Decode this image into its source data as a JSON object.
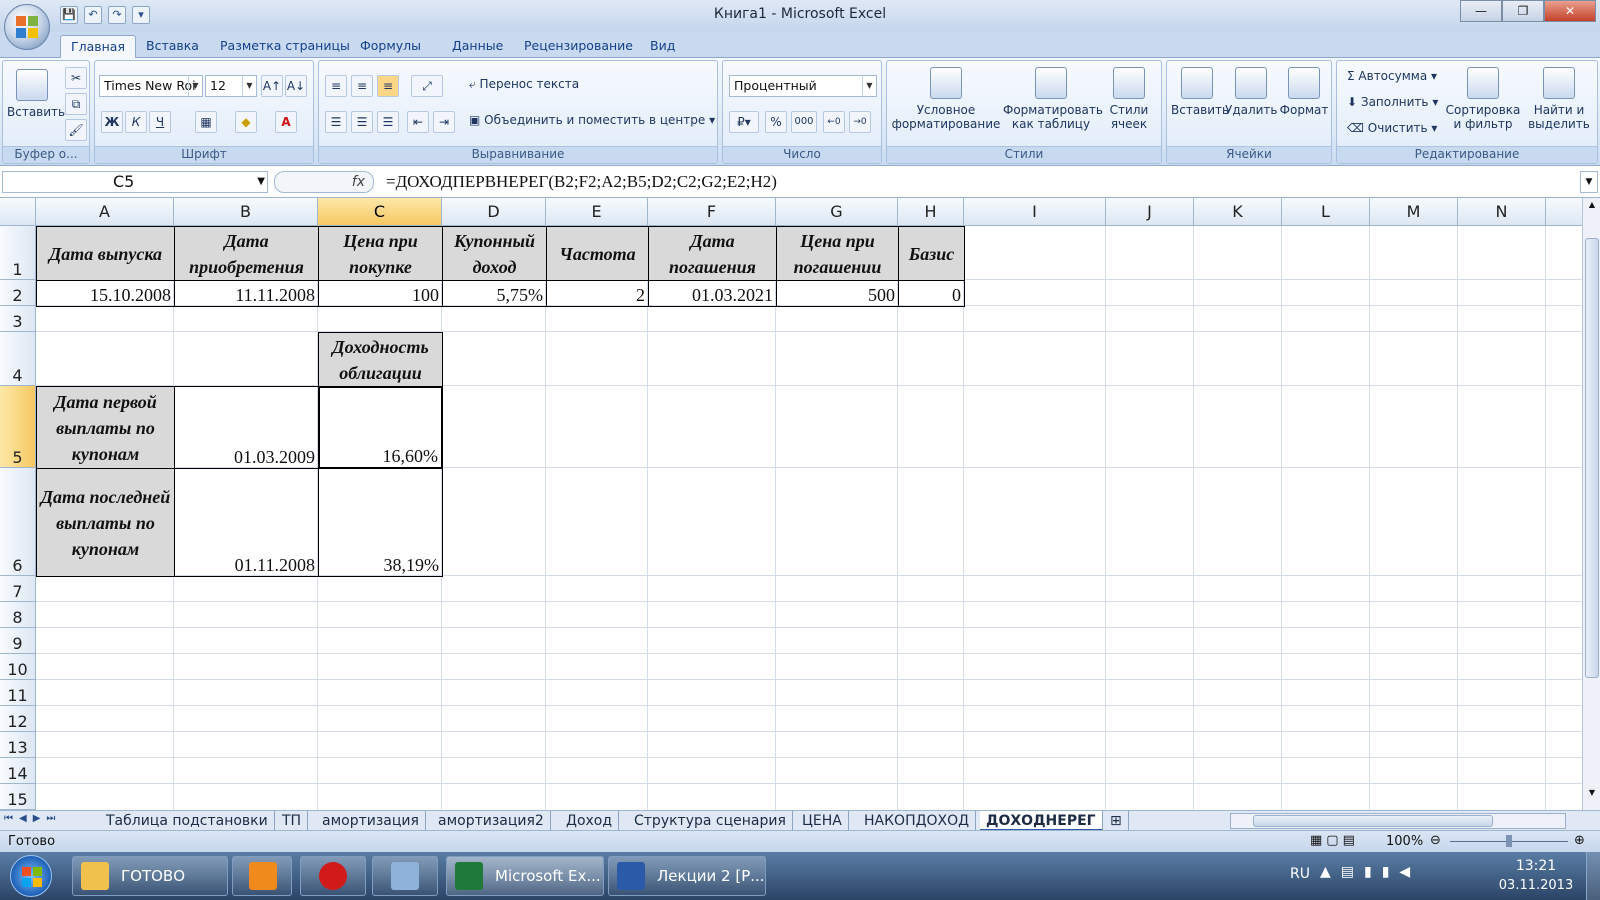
{
  "window": {
    "title": "Книга1 - Microsoft Excel",
    "min": "—",
    "max": "❐",
    "close": "✕"
  },
  "qat": [
    "💾",
    "↶",
    "↷",
    "▾"
  ],
  "tabs": [
    "Главная",
    "Вставка",
    "Разметка страницы",
    "Формулы",
    "Данные",
    "Рецензирование",
    "Вид"
  ],
  "ribbon": {
    "clipboard": {
      "paste": "Вставить",
      "label": "Буфер о..."
    },
    "font": {
      "name": "Times New Roi",
      "size": "12",
      "bold": "Ж",
      "italic": "К",
      "underline": "Ч",
      "label": "Шрифт"
    },
    "alignment": {
      "wrap": "Перенос текста",
      "merge": "Объединить и поместить в центре",
      "label": "Выравнивание"
    },
    "number": {
      "format": "Процентный",
      "percent": "%",
      "thousands": "000",
      "label": "Число"
    },
    "styles": {
      "cond1": "Условное",
      "cond2": "форматирование",
      "table1": "Форматировать",
      "table2": "как таблицу",
      "cell1": "Стили",
      "cell2": "ячеек",
      "label": "Стили"
    },
    "cells": {
      "insert": "Вставить",
      "delete": "Удалить",
      "format": "Формат",
      "label": "Ячейки"
    },
    "editing": {
      "autosum": "Автосумма",
      "fill": "Заполнить",
      "clear": "Очистить",
      "sort1": "Сортировка",
      "sort2": "и фильтр",
      "find1": "Найти и",
      "find2": "выделить",
      "label": "Редактирование"
    }
  },
  "formula_bar": {
    "cell": "C5",
    "fx": "fx",
    "formula": "=ДОХОДПЕРВНЕРЕГ(B2;F2;A2;B5;D2;C2;G2;E2;H2)"
  },
  "columns": [
    "A",
    "B",
    "C",
    "D",
    "E",
    "F",
    "G",
    "H",
    "I",
    "J",
    "K",
    "L",
    "M",
    "N"
  ],
  "rows": [
    "1",
    "2",
    "3",
    "4",
    "5",
    "6",
    "7",
    "8",
    "9",
    "10",
    "11",
    "12",
    "13",
    "14",
    "15"
  ],
  "cells": {
    "A1": "Дата выпуска",
    "B1": "Дата приобретения",
    "C1": "Цена при покупке",
    "D1": "Купонный доход",
    "E1": "Частота",
    "F1": "Дата погашения",
    "G1": "Цена при погашении",
    "H1": "Базис",
    "A2": "15.10.2008",
    "B2": "11.11.2008",
    "C2": "100",
    "D2": "5,75%",
    "E2": "2",
    "F2": "01.03.2021",
    "G2": "500",
    "H2": "0",
    "C4": "Доходность облигации",
    "A5": "Дата первой выплаты по купонам",
    "B5": "01.03.2009",
    "C5": "16,60%",
    "A6": "Дата последней выплаты по купонам",
    "B6": "01.11.2008",
    "C6": "38,19%"
  },
  "sheet_tabs": [
    "Таблица подстановки",
    "ТП",
    "амортизация",
    "амортизация2",
    "Доход",
    "Структура сценария",
    "ЦЕНА",
    "НАКОПДОХОД",
    "ДОХОДНЕРЕГ"
  ],
  "status": {
    "text": "Готово",
    "zoom": "100%"
  },
  "taskbar": {
    "items": [
      "ГОТОВО",
      "Microsoft Ex...",
      "Лекции 2 [Р..."
    ],
    "lang": "RU",
    "time": "13:21",
    "date": "03.11.2013"
  }
}
